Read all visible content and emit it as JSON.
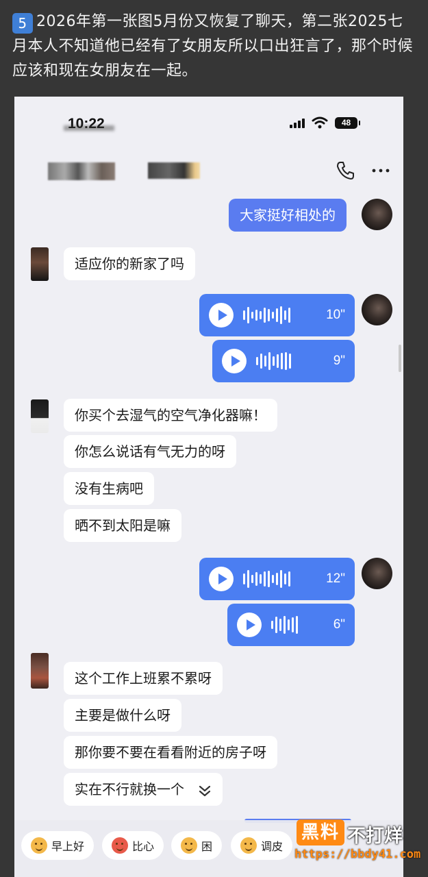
{
  "caption": {
    "index": "5",
    "text": "2026年第一张图5月份又恢复了聊天，第二张2025七月本人不知道他已经有了女朋友所以口出狂言了，那个时候应该和现在女朋友在一起。"
  },
  "status_bar": {
    "time": "10:22",
    "battery": "48"
  },
  "chat": {
    "messages": [
      {
        "from": "me",
        "type": "text",
        "text": "大家挺好相处的"
      },
      {
        "from": "them",
        "type": "text",
        "text": "适应你的新家了吗"
      },
      {
        "from": "me",
        "type": "voice",
        "duration": "10\""
      },
      {
        "from": "me",
        "type": "voice",
        "duration": "9\""
      },
      {
        "from": "them",
        "type": "text",
        "text": "你买个去湿气的空气净化器嘛！"
      },
      {
        "from": "them",
        "type": "text",
        "text": "你怎么说话有气无力的呀"
      },
      {
        "from": "them",
        "type": "text",
        "text": "没有生病吧"
      },
      {
        "from": "them",
        "type": "text",
        "text": "晒不到太阳是嘛"
      },
      {
        "from": "me",
        "type": "voice",
        "duration": "12\""
      },
      {
        "from": "me",
        "type": "voice",
        "duration": "6\""
      },
      {
        "from": "them",
        "type": "text",
        "text": "这个工作上班累不累呀"
      },
      {
        "from": "them",
        "type": "text",
        "text": "主要是做什么呀"
      },
      {
        "from": "them",
        "type": "text",
        "text": "那你要不要在看看附近的房子呀"
      },
      {
        "from": "them",
        "type": "text",
        "text": "实在不行就换一个"
      }
    ]
  },
  "quick_replies": [
    "早上好",
    "比心",
    "困",
    "调皮"
  ],
  "watermark": {
    "badge": "黑料",
    "text": "不打烊",
    "url": "https://bbdy41.com"
  },
  "colors": {
    "page_bg": "#363636",
    "chat_bg": "#efeff4",
    "my_bubble": "#5a7cf0",
    "voice_bubble": "#4b7ef2",
    "watermark": "#ff8a14"
  }
}
